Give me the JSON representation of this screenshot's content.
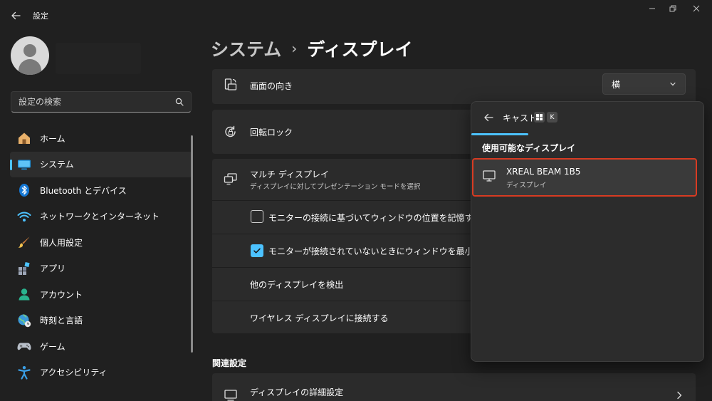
{
  "window": {
    "title": "設定"
  },
  "sidebar": {
    "search_placeholder": "設定の検索",
    "items": [
      {
        "label": "ホーム",
        "icon": "home-icon",
        "active": false
      },
      {
        "label": "システム",
        "icon": "system-icon",
        "active": true
      },
      {
        "label": "Bluetooth とデバイス",
        "icon": "bluetooth-icon",
        "active": false
      },
      {
        "label": "ネットワークとインターネット",
        "icon": "wifi-icon",
        "active": false
      },
      {
        "label": "個人用設定",
        "icon": "paintbrush-icon",
        "active": false
      },
      {
        "label": "アプリ",
        "icon": "apps-icon",
        "active": false
      },
      {
        "label": "アカウント",
        "icon": "account-icon",
        "active": false
      },
      {
        "label": "時刻と言語",
        "icon": "globe-clock-icon",
        "active": false
      },
      {
        "label": "ゲーム",
        "icon": "gamepad-icon",
        "active": false
      },
      {
        "label": "アクセシビリティ",
        "icon": "accessibility-icon",
        "active": false
      }
    ]
  },
  "breadcrumb": {
    "parent": "システム",
    "separator": "›",
    "current": "ディスプレイ"
  },
  "settings": {
    "orientation": {
      "title": "画面の向き",
      "value": "横"
    },
    "rotation_lock": {
      "title": "回転ロック"
    },
    "multi_display": {
      "title": "マルチ ディスプレイ",
      "subtitle": "ディスプレイに対してプレゼンテーション モードを選択"
    },
    "remember_window": {
      "label": "モニターの接続に基づいてウィンドウの位置を記憶する",
      "checked": false
    },
    "minimize_window": {
      "label": "モニターが接続されていないときにウィンドウを最小化する",
      "checked": true
    },
    "detect_other": {
      "title": "他のディスプレイを検出"
    },
    "wireless_connect": {
      "title": "ワイヤレス ディスプレイに接続する"
    }
  },
  "related": {
    "heading": "関連設定",
    "advanced_display": {
      "title": "ディスプレイの詳細設定"
    }
  },
  "cast_flyout": {
    "title": "キャスト",
    "shortcut_key": "K",
    "section": "使用可能なディスプレイ",
    "devices": [
      {
        "name": "XREAL BEAM 1B5",
        "type": "ディスプレイ"
      }
    ]
  },
  "colors": {
    "background": "#202020",
    "card": "#2b2b2b",
    "accent": "#4cc2ff",
    "highlight_border": "#d83b22"
  }
}
